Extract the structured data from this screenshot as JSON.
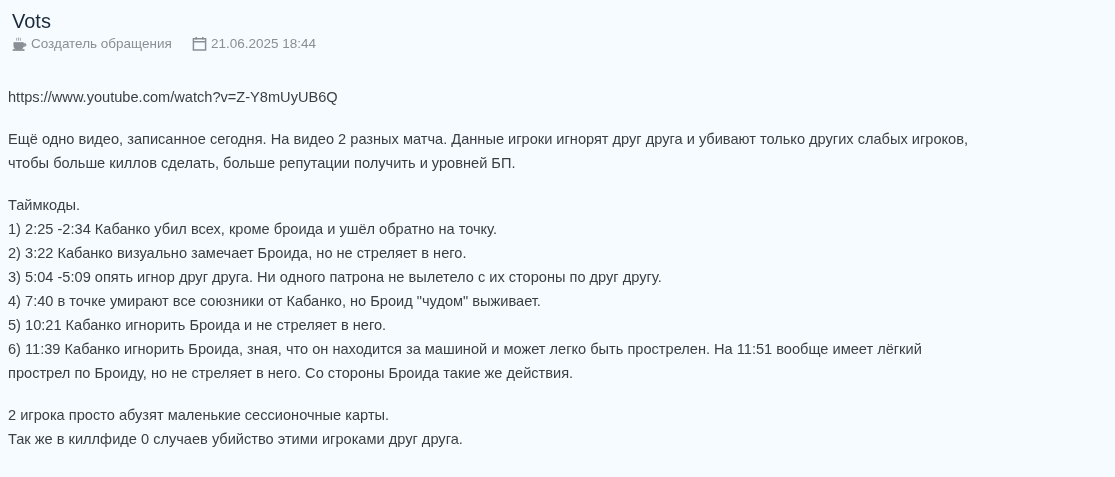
{
  "title": "Vots",
  "meta": {
    "author": "Создатель обращения",
    "date": "21.06.2025 18:44"
  },
  "paragraphs": [
    {
      "lines": [
        "https://www.youtube.com/watch?v=Z-Y8mUyUB6Q"
      ]
    },
    {
      "lines": [
        "Ещё одно видео, записанное сегодня. На видео 2 разных матча. Данные игроки игнорят друг друга и убивают только других слабых игроков,",
        "чтобы больше киллов сделать, больше репутации получить и уровней БП."
      ]
    },
    {
      "lines": [
        "Таймкоды.",
        "1) 2:25 -2:34 Кабанко убил всех, кроме броида и ушёл обратно на точку.",
        "2) 3:22 Кабанко визуально замечает Броида, но не стреляет в него.",
        "3) 5:04 -5:09 опять игнор друг друга. Ни одного патрона не вылетело с их стороны по друг другу.",
        "4) 7:40 в точке умирают все союзники от Кабанко, но Броид \"чудом\" выживает.",
        "5) 10:21 Кабанко игнорить Броида и не стреляет в него.",
        "6) 11:39 Кабанко игнорить Броида, зная, что он находится за машиной и может легко быть прострелен. На 11:51 вообще имеет лёгкий",
        "прострел по Броиду, но не стреляет в него. Со стороны Броида такие же действия."
      ]
    },
    {
      "lines": [
        "2 игрока просто абузят маленькие сессионочные карты.",
        "Так же в киллфиде 0 случаев убийство этими игроками друг друга."
      ]
    }
  ]
}
